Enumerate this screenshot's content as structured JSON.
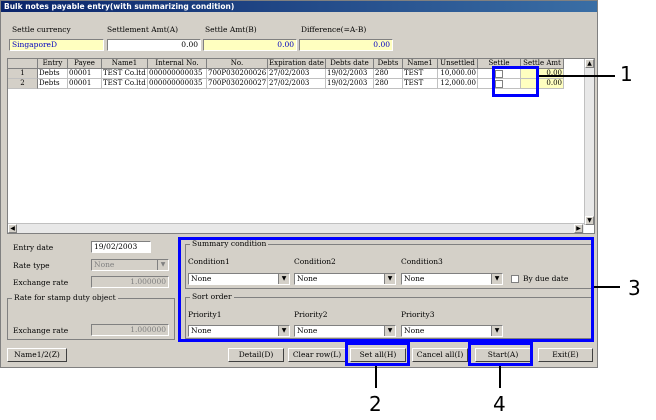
{
  "window": {
    "title": "Bulk notes payable entry(with summarizing condition)"
  },
  "header": {
    "settle_currency_label": "Settle currency",
    "settlement_amt_label": "Settlement Amt(A)",
    "settle_amt_b_label": "Settle Amt(B)",
    "difference_label": "Difference(=A-B)",
    "settle_currency_value": "SingaporeD",
    "settlement_amt_value": "0.00",
    "settle_amt_b_value": "0.00",
    "difference_value": "0.00"
  },
  "grid": {
    "columns": [
      "",
      "Entry",
      "Payee",
      "Name1",
      "Internal No.",
      "No.",
      "Expiration date",
      "Debts date",
      "Debts",
      "Name1",
      "Unsettled",
      "Settle",
      "Settle Amt"
    ],
    "rows": [
      {
        "num": "1",
        "entry": "Debts",
        "payee": "00001",
        "name1": "TEST Co.ltd",
        "internal_no": "000000000035",
        "no": "700P030200026",
        "expiration": "27/02/2003",
        "debts_date": "19/02/2003",
        "debts": "280",
        "name1b": "TEST",
        "unsettled": "10,000.00",
        "settle_amt": "0.00"
      },
      {
        "num": "2",
        "entry": "Debts",
        "payee": "00001",
        "name1": "TEST Co.ltd",
        "internal_no": "000000000035",
        "no": "700P030200027",
        "expiration": "27/02/2003",
        "debts_date": "19/02/2003",
        "debts": "280",
        "name1b": "TEST",
        "unsettled": "12,000.00",
        "settle_amt": "0.00"
      }
    ]
  },
  "entry": {
    "entry_date_label": "Entry date",
    "entry_date_value": "19/02/2003",
    "rate_type_label": "Rate type",
    "rate_type_value": "None",
    "exchange_rate_label": "Exchange rate",
    "exchange_rate_value": "1.000000",
    "stamp_group_label": "Rate for stamp duty object",
    "stamp_exchange_rate_label": "Exchange rate",
    "stamp_exchange_rate_value": "1.000000"
  },
  "summary": {
    "group_label": "Summary condition",
    "condition1_label": "Condition1",
    "condition2_label": "Condition2",
    "condition3_label": "Condition3",
    "condition1_value": "None",
    "condition2_value": "None",
    "condition3_value": "None",
    "by_due_date_label": "By due date"
  },
  "sort": {
    "group_label": "Sort order",
    "priority1_label": "Priority1",
    "priority2_label": "Priority2",
    "priority3_label": "Priority3",
    "priority1_value": "None",
    "priority2_value": "None",
    "priority3_value": "None"
  },
  "buttons": {
    "name12": "Name1/2(Z)",
    "detail": "Detail(D)",
    "clear_row": "Clear row(L)",
    "set_all": "Set all(H)",
    "cancel_all": "Cancel all(I)",
    "start": "Start(A)",
    "exit": "Exit(E)"
  },
  "callouts": {
    "c1": "1",
    "c2": "2",
    "c3": "3",
    "c4": "4"
  },
  "colors": {
    "highlight": "#0000ff",
    "title_bar": "#0a246a",
    "yellow_field": "#ffffc0"
  }
}
